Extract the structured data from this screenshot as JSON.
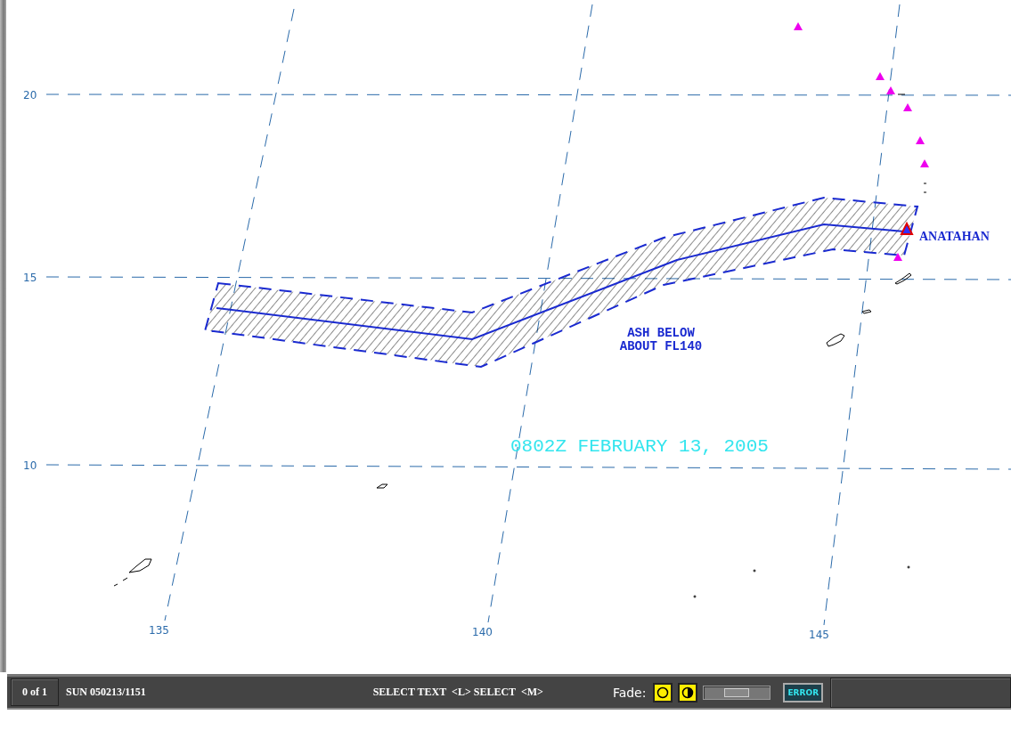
{
  "map": {
    "latitude_labels": [
      "20",
      "15",
      "10"
    ],
    "longitude_labels": [
      "135",
      "140",
      "145"
    ],
    "advisory_text": [
      "ASH BELOW",
      "ABOUT FL140"
    ],
    "volcano_label": "ANATAHAN",
    "timestamp": "0802Z FEBRUARY 13, 2005"
  },
  "status_bar": {
    "frame_counter": "0 of 1",
    "datetime": "SUN 050213/1151",
    "prompt": "SELECT TEXT  <L> SELECT  <M>",
    "fade_label": "Fade:",
    "fade_slider": {
      "level": 0.5
    },
    "error_button": "ERROR"
  }
}
